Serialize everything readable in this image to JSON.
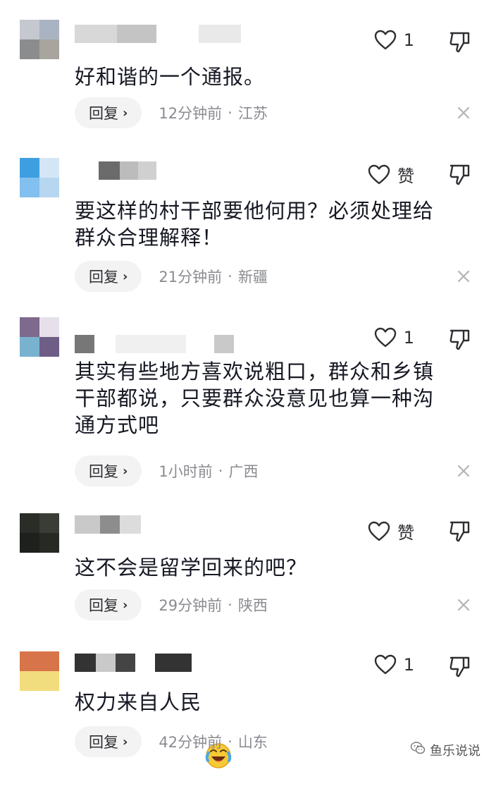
{
  "comments": [
    {
      "text": "好和谐的一个通报。",
      "like_label": "1",
      "reply_label": "回复",
      "time": "12分钟前",
      "location": "江苏",
      "dot": "·",
      "avatar_colors": [
        "#c5c9cf",
        "#aab3c2",
        "#8b8c8e",
        "#a8a59f"
      ],
      "name_colors": [
        "#d8d8d8",
        "#c4c4c4",
        "#e9e9e9"
      ]
    },
    {
      "text": "要这样的村干部要他何用？必须处理给\n群众合理解释！",
      "like_label": "赞",
      "reply_label": "回复",
      "time": "21分钟前",
      "location": "新疆",
      "dot": "·",
      "avatar_colors": [
        "#3e9fe0",
        "#d4e6f6",
        "#82c0ef",
        "#b7d6ef"
      ],
      "name_colors": [
        "#6b6b6b",
        "#bcbcbc",
        "#d0d0d0"
      ]
    },
    {
      "text": "其实有些地方喜欢说粗口，群众和乡镇\n干部都说，只要群众没意见也算一种沟\n通方式吧",
      "like_label": "1",
      "reply_label": "回复",
      "time": "1小时前",
      "location": "广西",
      "dot": "·",
      "avatar_colors": [
        "#7d6a8c",
        "#e6e0ea",
        "#79b2cf",
        "#6e5e86"
      ],
      "name_colors": [
        "#777777",
        "#f0f0f0",
        "#c9c9c9"
      ]
    },
    {
      "text": "这不会是留学回来的吧？",
      "like_label": "赞",
      "reply_label": "回复",
      "time": "29分钟前",
      "location": "陕西",
      "dot": "·",
      "avatar_colors": [
        "#2a2d27",
        "#3a3d35",
        "#1d201c",
        "#262924"
      ],
      "name_colors": [
        "#c9c9c9",
        "#8d8d8d",
        "#dcdcdc"
      ]
    },
    {
      "text": "权力来自人民",
      "like_label": "1",
      "reply_label": "回复",
      "time": "42分钟前",
      "location": "山东",
      "dot": "·",
      "emoji": "laugh-cry-emoji",
      "avatar_colors": [
        "#d8744a",
        "#d8744a",
        "#f2dd7e",
        "#f2dd7e"
      ],
      "name_colors": [
        "#333333",
        "#c9c9c9",
        "#444444"
      ]
    }
  ],
  "watermark": {
    "text": "鱼乐说说",
    "icon": "wechat-icon"
  }
}
